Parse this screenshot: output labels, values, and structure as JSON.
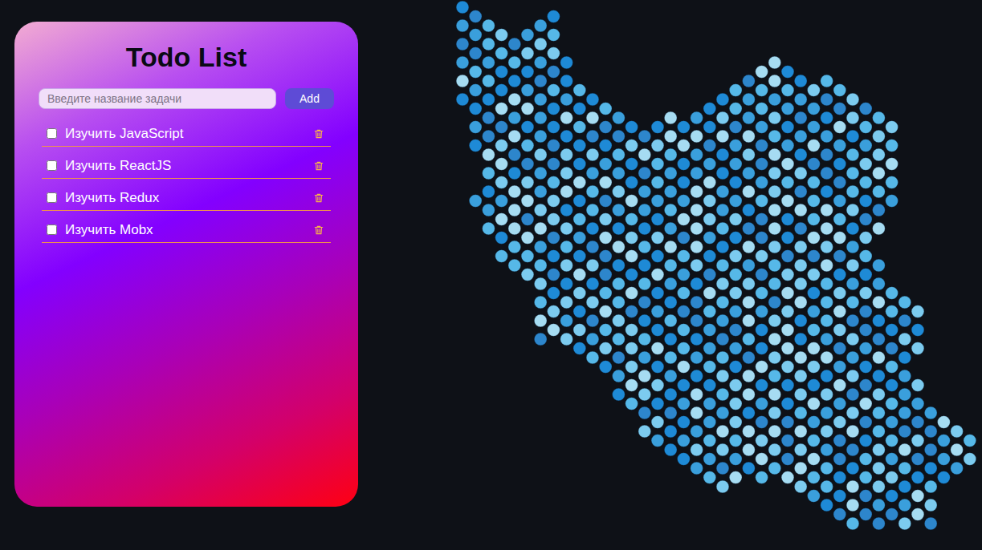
{
  "title": "Todo List",
  "input": {
    "placeholder": "Введите название задачи"
  },
  "add_button": "Add",
  "todos": [
    {
      "text": "Изучить JavaScript",
      "checked": false
    },
    {
      "text": "Изучить ReactJS",
      "checked": false
    },
    {
      "text": "Изучить Redux",
      "checked": false
    },
    {
      "text": "Изучить Mobx",
      "checked": false
    }
  ]
}
